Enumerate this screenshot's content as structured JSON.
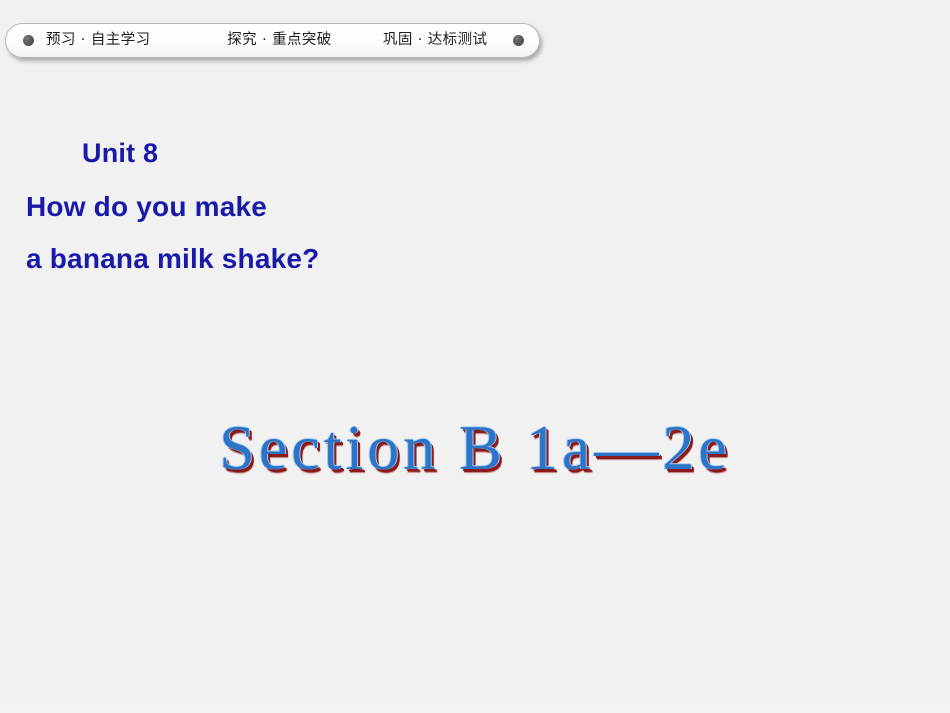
{
  "slide": {
    "background_color": "#f1f1f1",
    "heading_color": "#1a1aa8",
    "wordart_fill_color": "#2b74c8",
    "wordart_shadow_color": "#8d1a1a",
    "wordart_glow_color": "#9ec9ee"
  },
  "nav": {
    "items": [
      {
        "label": "预习 · 自主学习"
      },
      {
        "label": "探究 · 重点突破"
      },
      {
        "label": "巩固 · 达标测试"
      }
    ],
    "left_dot": "bullet-dot",
    "right_dot": "bullet-dot"
  },
  "heading": {
    "unit": "Unit 8",
    "question_line_1": "How do you make",
    "question_line_2": "a banana milk shake?"
  },
  "wordart": {
    "title": "Section B  1a—2e"
  }
}
